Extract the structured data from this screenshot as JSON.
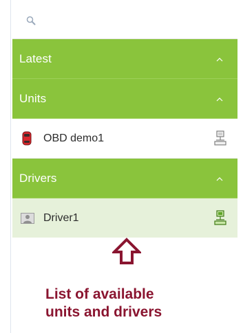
{
  "search": {
    "value": "",
    "placeholder": ""
  },
  "sections": {
    "latest": {
      "title": "Latest",
      "expanded": true
    },
    "units": {
      "title": "Units",
      "expanded": true,
      "items": [
        {
          "label": "OBD demo1",
          "icon": "car-icon",
          "status_icon": "network-icon",
          "status": "offline"
        }
      ]
    },
    "drivers": {
      "title": "Drivers",
      "expanded": true,
      "items": [
        {
          "label": "Driver1",
          "icon": "driver-avatar-icon",
          "status_icon": "network-icon",
          "status": "online"
        }
      ]
    }
  },
  "annotation": {
    "line1": "List of available",
    "line2": "units and drivers",
    "arrow_icon": "arrow-up-icon"
  },
  "colors": {
    "section_header": "#8ac43c",
    "selected_item": "#e6f1da",
    "caption": "#8a1530",
    "online": "#4a8a1d",
    "offline": "#808080"
  }
}
